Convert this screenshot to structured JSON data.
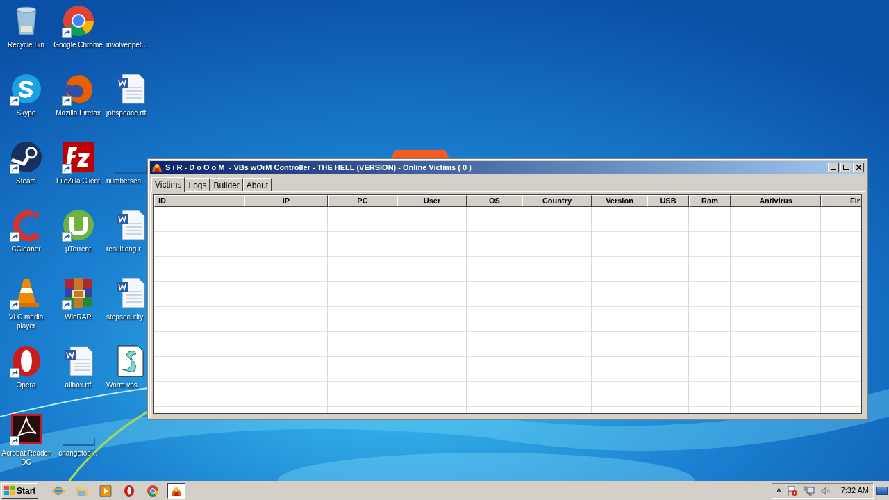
{
  "desktop_icons": [
    {
      "label": "Recycle Bin",
      "kind": "recycle",
      "shortcut": false
    },
    {
      "label": "Google Chrome",
      "kind": "chrome",
      "shortcut": true
    },
    {
      "label": "involvedpet…",
      "kind": "blank",
      "shortcut": false
    },
    {
      "label": "Skype",
      "kind": "skype",
      "shortcut": true
    },
    {
      "label": "Mozilla Firefox",
      "kind": "firefox",
      "shortcut": true
    },
    {
      "label": "jobspeace.rtf",
      "kind": "word",
      "shortcut": false
    },
    {
      "label": "Steam",
      "kind": "steam",
      "shortcut": true
    },
    {
      "label": "FileZilla Client",
      "kind": "filezilla",
      "shortcut": true
    },
    {
      "label": "numbersen",
      "kind": "blank",
      "shortcut": false
    },
    {
      "label": "CCleaner",
      "kind": "ccleaner",
      "shortcut": true
    },
    {
      "label": "µTorrent",
      "kind": "utorrent",
      "shortcut": true
    },
    {
      "label": "resultlong.r",
      "kind": "word",
      "shortcut": false
    },
    {
      "label": "VLC media player",
      "kind": "vlc",
      "shortcut": true
    },
    {
      "label": "WinRAR",
      "kind": "winrar",
      "shortcut": true
    },
    {
      "label": "stepsecurity",
      "kind": "word",
      "shortcut": false
    },
    {
      "label": "Opera",
      "kind": "opera",
      "shortcut": true
    },
    {
      "label": "allbox.rtf",
      "kind": "word",
      "shortcut": false
    },
    {
      "label": "Worm.vbs",
      "kind": "script",
      "shortcut": false
    },
    {
      "label": "Acrobat Reader DC",
      "kind": "acrobat",
      "shortcut": true
    },
    {
      "label": "changetop…",
      "kind": "blank",
      "shortcut": false
    }
  ],
  "window": {
    "title": "S i R - D o O o M  - VBs wOrM Controller - THE HELL (VERSION) - Online Victims ( 0 )",
    "tabs": [
      {
        "label": "Victims",
        "selected": true
      },
      {
        "label": "Logs",
        "selected": false
      },
      {
        "label": "Builder",
        "selected": false
      },
      {
        "label": "About",
        "selected": false
      }
    ],
    "table": {
      "columns": [
        "ID",
        "IP",
        "PC",
        "User",
        "OS",
        "Country",
        "Version",
        "USB",
        "Ram",
        "Antivirus",
        "Fir"
      ]
    }
  },
  "taskbar": {
    "start": "Start",
    "apps": [
      {
        "kind": "ie",
        "selected": false
      },
      {
        "kind": "folder",
        "selected": false
      },
      {
        "kind": "media",
        "selected": false
      },
      {
        "kind": "opera",
        "selected": false
      },
      {
        "kind": "chrome",
        "selected": false
      },
      {
        "kind": "app",
        "selected": true
      }
    ],
    "tray": {
      "chevron": "˄",
      "time": "7:32 AM"
    }
  }
}
